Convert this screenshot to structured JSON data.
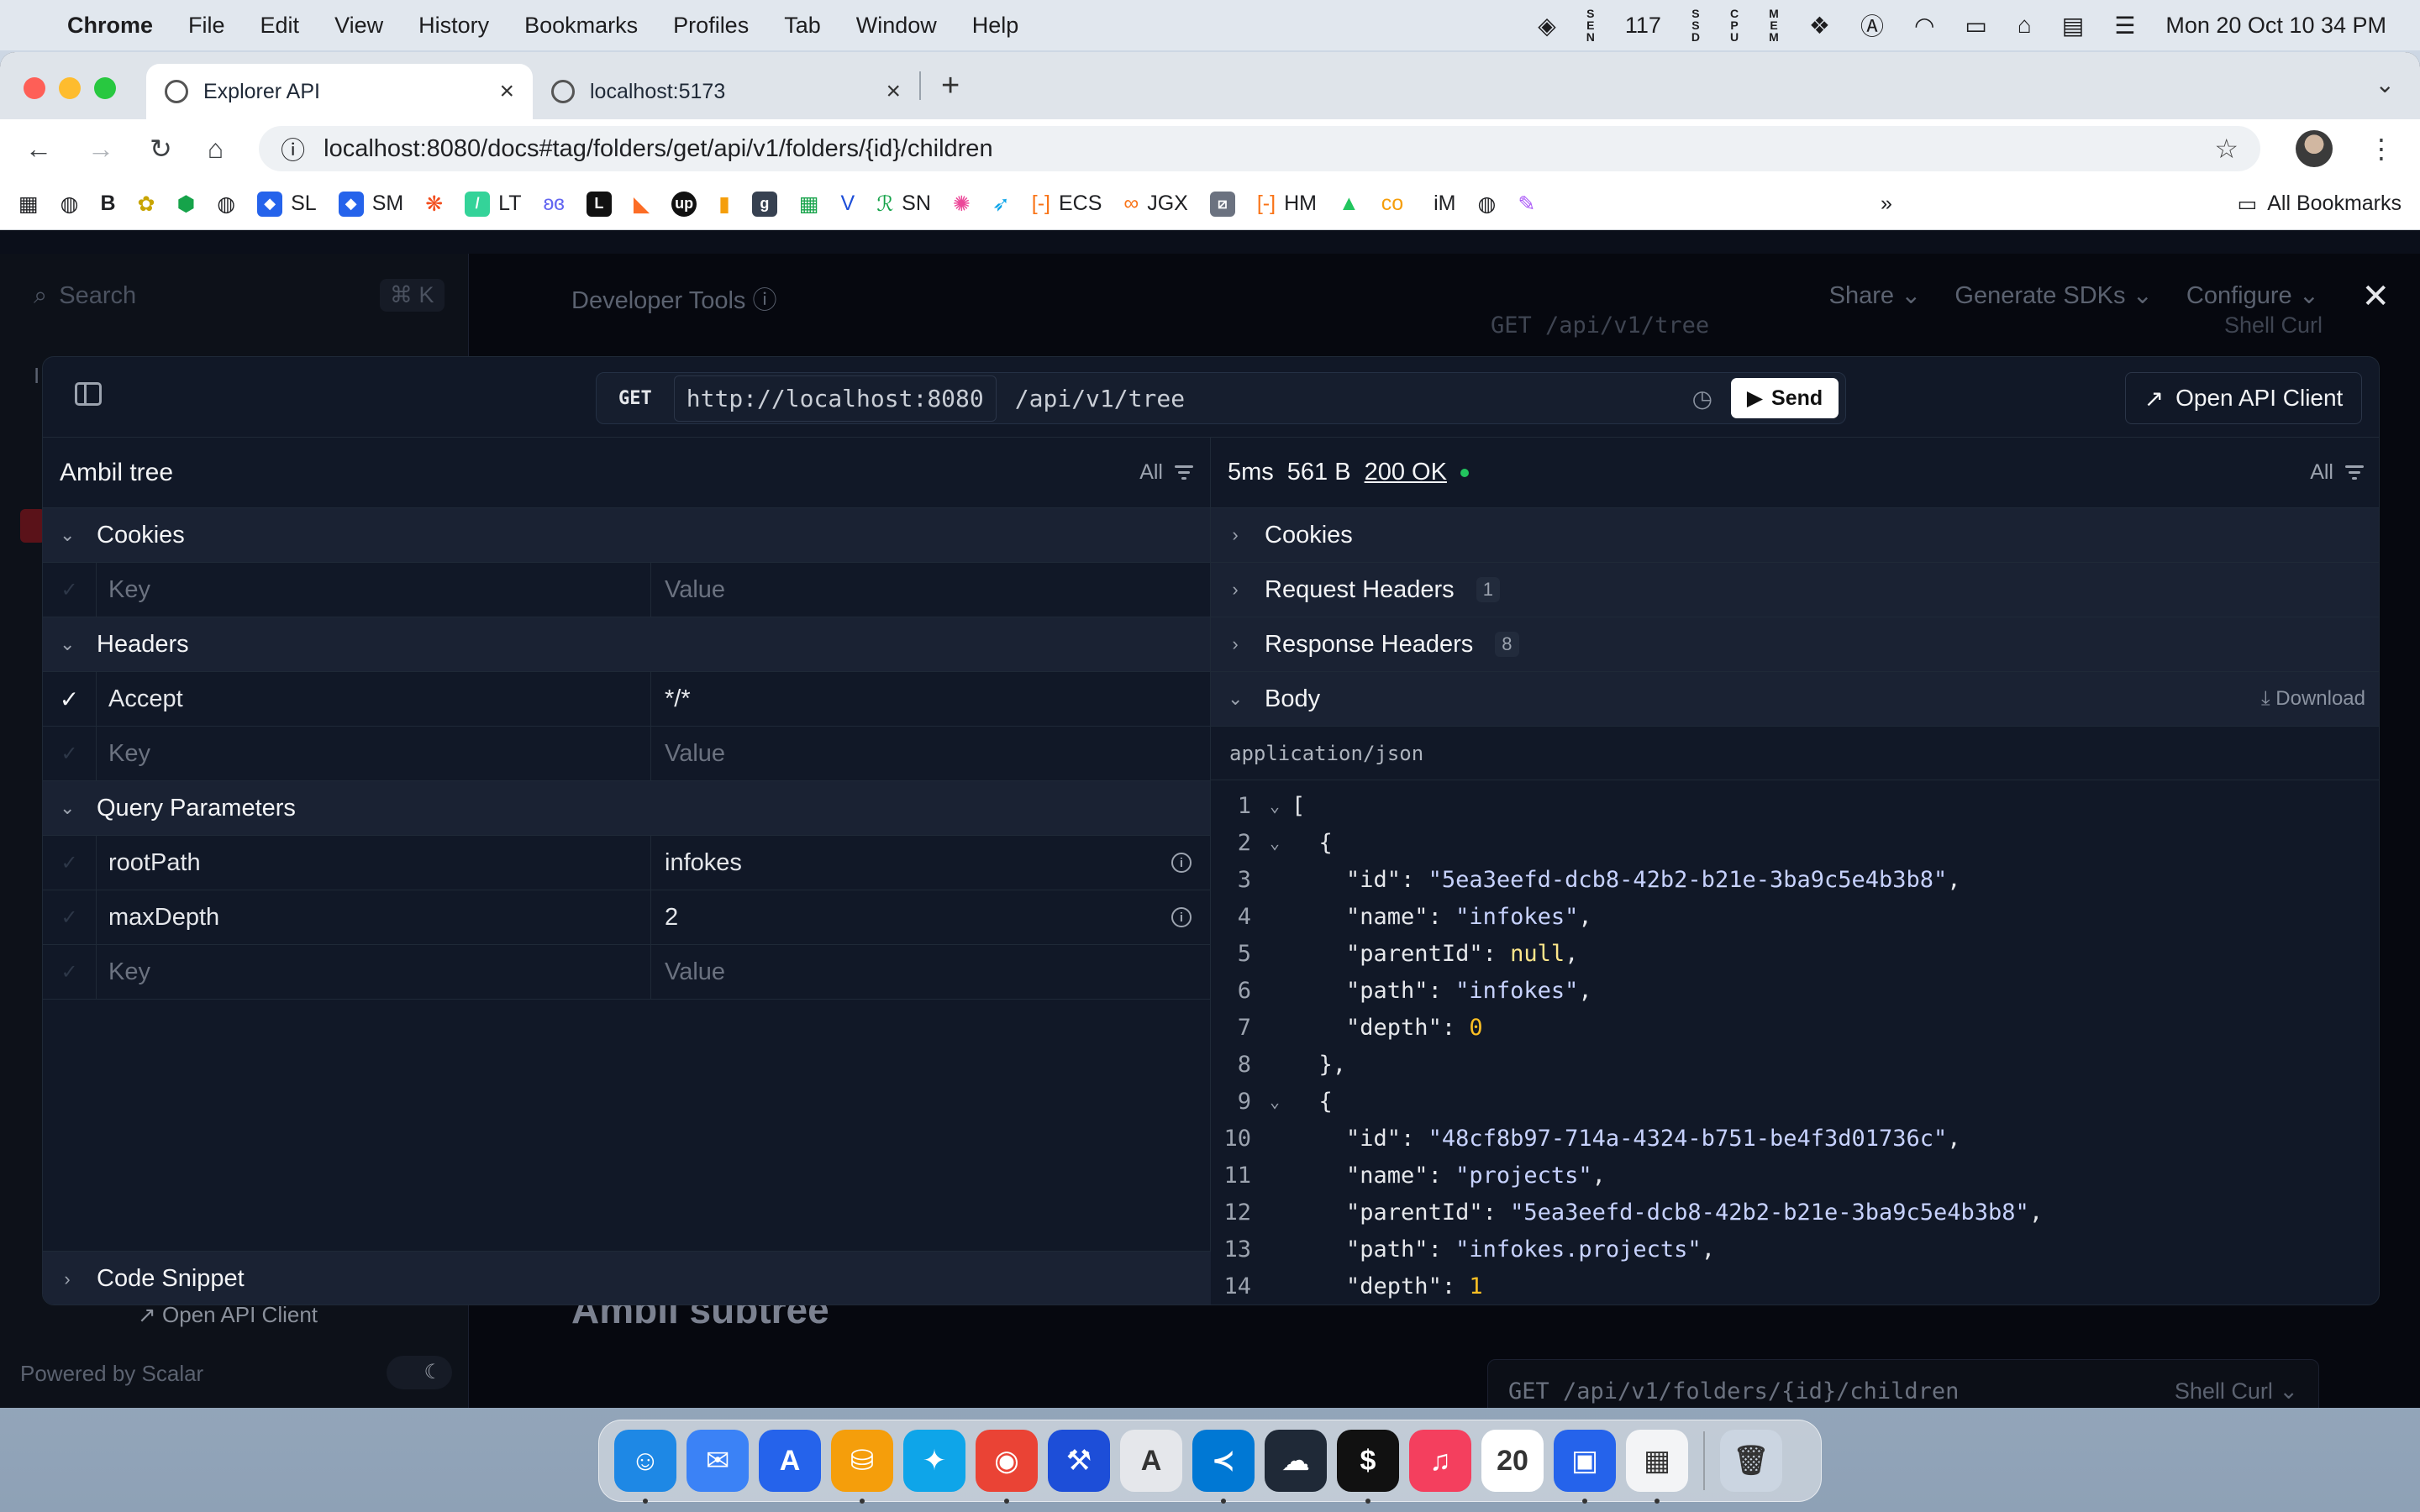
{
  "menubar": {
    "app_name": "Chrome",
    "items": [
      "File",
      "Edit",
      "View",
      "History",
      "Bookmarks",
      "Profiles",
      "Tab",
      "Window",
      "Help"
    ],
    "status": {
      "num": "117",
      "clock": "Mon 20 Oct  10 34 PM"
    }
  },
  "browser": {
    "tabs": [
      {
        "title": "Explorer API",
        "active": true
      },
      {
        "title": "localhost:5173",
        "active": false
      }
    ],
    "url": "localhost:8080/docs#tag/folders/get/api/v1/folders/{id}/children",
    "bookmarks": [
      "SL",
      "SM",
      "LT",
      "SN",
      "ECS",
      "JGX",
      "HM",
      "iM"
    ],
    "all_bookmarks": "All Bookmarks"
  },
  "background_page": {
    "search_placeholder": "Search",
    "search_kbd": "⌘ K",
    "developer_tools": "Developer Tools",
    "header_menus": [
      "Share",
      "Generate SDKs",
      "Configure"
    ],
    "code_top": "GET /api/v1/tree",
    "code_top_lang": "Shell Curl",
    "heading": "Ambil subtree",
    "open_api_client": "Open API Client",
    "powered_by": "Powered by Scalar",
    "bottom_code": "GET /api/v1/folders/{id}/children",
    "bottom_code_lang": "Shell Curl"
  },
  "client": {
    "method": "GET",
    "base_url": "http://localhost:8080",
    "path": "/api/v1/tree",
    "send_label": "Send",
    "open_client_label": "Open API Client",
    "request": {
      "title": "Ambil tree",
      "filter": "All",
      "sections": {
        "cookies": "Cookies",
        "headers": "Headers",
        "query": "Query Parameters",
        "snippet": "Code Snippet"
      },
      "key_placeholder": "Key",
      "value_placeholder": "Value",
      "headers": [
        {
          "key": "Accept",
          "value": "*/*",
          "enabled": true
        }
      ],
      "query": [
        {
          "key": "rootPath",
          "value": "infokes"
        },
        {
          "key": "maxDepth",
          "value": "2"
        }
      ]
    },
    "response": {
      "time": "5ms",
      "size": "561 B",
      "status": "200 OK",
      "filter": "All",
      "sections": {
        "cookies": "Cookies",
        "request_headers": "Request Headers",
        "request_headers_count": "1",
        "response_headers": "Response Headers",
        "response_headers_count": "8",
        "body": "Body",
        "download": "Download"
      },
      "content_type": "application/json",
      "lines": [
        {
          "n": "1",
          "fold": true,
          "parts": [
            [
              "p",
              "["
            ]
          ]
        },
        {
          "n": "2",
          "fold": true,
          "parts": [
            [
              "p",
              "  {"
            ]
          ]
        },
        {
          "n": "3",
          "fold": false,
          "parts": [
            [
              "p",
              "    "
            ],
            [
              "k",
              "\"id\""
            ],
            [
              "p",
              ": "
            ],
            [
              "s",
              "\"5ea3eefd-dcb8-42b2-b21e-3ba9c5e4b3b8\""
            ],
            [
              "p",
              ","
            ]
          ]
        },
        {
          "n": "4",
          "fold": false,
          "parts": [
            [
              "p",
              "    "
            ],
            [
              "k",
              "\"name\""
            ],
            [
              "p",
              ": "
            ],
            [
              "s",
              "\"infokes\""
            ],
            [
              "p",
              ","
            ]
          ]
        },
        {
          "n": "5",
          "fold": false,
          "parts": [
            [
              "p",
              "    "
            ],
            [
              "k",
              "\"parentId\""
            ],
            [
              "p",
              ": "
            ],
            [
              "z",
              "null"
            ],
            [
              "p",
              ","
            ]
          ]
        },
        {
          "n": "6",
          "fold": false,
          "parts": [
            [
              "p",
              "    "
            ],
            [
              "k",
              "\"path\""
            ],
            [
              "p",
              ": "
            ],
            [
              "s",
              "\"infokes\""
            ],
            [
              "p",
              ","
            ]
          ]
        },
        {
          "n": "7",
          "fold": false,
          "parts": [
            [
              "p",
              "    "
            ],
            [
              "k",
              "\"depth\""
            ],
            [
              "p",
              ": "
            ],
            [
              "n",
              "0"
            ]
          ]
        },
        {
          "n": "8",
          "fold": false,
          "parts": [
            [
              "p",
              "  },"
            ]
          ]
        },
        {
          "n": "9",
          "fold": true,
          "parts": [
            [
              "p",
              "  {"
            ]
          ]
        },
        {
          "n": "10",
          "fold": false,
          "parts": [
            [
              "p",
              "    "
            ],
            [
              "k",
              "\"id\""
            ],
            [
              "p",
              ": "
            ],
            [
              "s",
              "\"48cf8b97-714a-4324-b751-be4f3d01736c\""
            ],
            [
              "p",
              ","
            ]
          ]
        },
        {
          "n": "11",
          "fold": false,
          "parts": [
            [
              "p",
              "    "
            ],
            [
              "k",
              "\"name\""
            ],
            [
              "p",
              ": "
            ],
            [
              "s",
              "\"projects\""
            ],
            [
              "p",
              ","
            ]
          ]
        },
        {
          "n": "12",
          "fold": false,
          "parts": [
            [
              "p",
              "    "
            ],
            [
              "k",
              "\"parentId\""
            ],
            [
              "p",
              ": "
            ],
            [
              "s",
              "\"5ea3eefd-dcb8-42b2-b21e-3ba9c5e4b3b8\""
            ],
            [
              "p",
              ","
            ]
          ]
        },
        {
          "n": "13",
          "fold": false,
          "parts": [
            [
              "p",
              "    "
            ],
            [
              "k",
              "\"path\""
            ],
            [
              "p",
              ": "
            ],
            [
              "s",
              "\"infokes.projects\""
            ],
            [
              "p",
              ","
            ]
          ]
        },
        {
          "n": "14",
          "fold": false,
          "parts": [
            [
              "p",
              "    "
            ],
            [
              "k",
              "\"depth\""
            ],
            [
              "p",
              ": "
            ],
            [
              "n",
              "1"
            ]
          ]
        }
      ]
    }
  },
  "dock": {
    "apps": [
      {
        "name": "finder",
        "glyph": "☺",
        "color": "#1e88e5",
        "running": true
      },
      {
        "name": "mail",
        "glyph": "✉",
        "color": "#3b82f6",
        "running": false
      },
      {
        "name": "app-store",
        "glyph": "A",
        "color": "#2563eb",
        "running": false
      },
      {
        "name": "tableplus",
        "glyph": "⛁",
        "color": "#f59e0b",
        "running": true
      },
      {
        "name": "safari",
        "glyph": "✦",
        "color": "#0ea5e9",
        "running": false
      },
      {
        "name": "chrome",
        "glyph": "◉",
        "color": "#ea4335",
        "running": true
      },
      {
        "name": "xcode",
        "glyph": "⚒",
        "color": "#1d4ed8",
        "running": false
      },
      {
        "name": "instruments",
        "glyph": "A",
        "color": "#e5e7eb",
        "running": false
      },
      {
        "name": "vscode",
        "glyph": "≺",
        "color": "#0078d4",
        "running": true
      },
      {
        "name": "cloud-app",
        "glyph": "☁",
        "color": "#1f2937",
        "running": false
      },
      {
        "name": "terminal",
        "glyph": "$",
        "color": "#111111",
        "running": true
      },
      {
        "name": "music",
        "glyph": "♫",
        "color": "#f43f5e",
        "running": false
      },
      {
        "name": "calendar",
        "glyph": "20",
        "color": "#ffffff",
        "running": false
      },
      {
        "name": "remote-desktop",
        "glyph": "▣",
        "color": "#2563eb",
        "running": true
      },
      {
        "name": "notes-table",
        "glyph": "▦",
        "color": "#f3f4f6",
        "running": true
      },
      {
        "name": "trash",
        "glyph": "🗑",
        "color": "#cbd5e1",
        "running": false
      }
    ]
  }
}
